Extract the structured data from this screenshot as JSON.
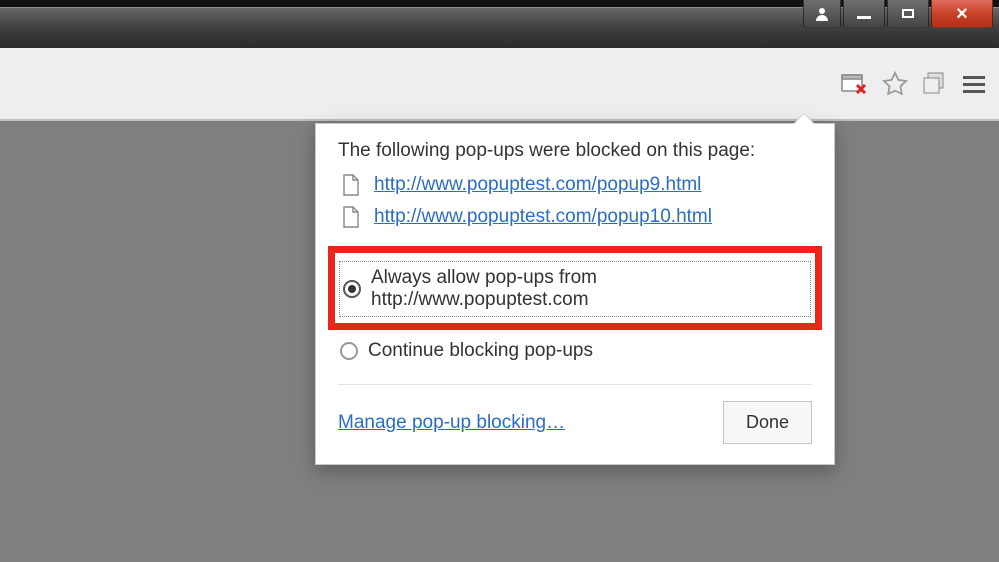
{
  "window": {
    "user_btn": "👤",
    "min": "–",
    "max": "▢",
    "close": "×"
  },
  "toolbar": {
    "popup_blocked_icon": "popup-blocked",
    "star_icon": "bookmark-star",
    "pages_icon": "pages",
    "menu_icon": "menu"
  },
  "popup": {
    "title": "The following pop-ups were blocked on this page:",
    "blocked": [
      {
        "url": "http://www.popuptest.com/popup9.html"
      },
      {
        "url": "http://www.popuptest.com/popup10.html"
      }
    ],
    "radio_allow_label": "Always allow pop-ups from http://www.popuptest.com",
    "radio_block_label": "Continue blocking pop-ups",
    "selected": "allow",
    "manage_link": "Manage pop-up blocking…",
    "done_label": "Done"
  }
}
